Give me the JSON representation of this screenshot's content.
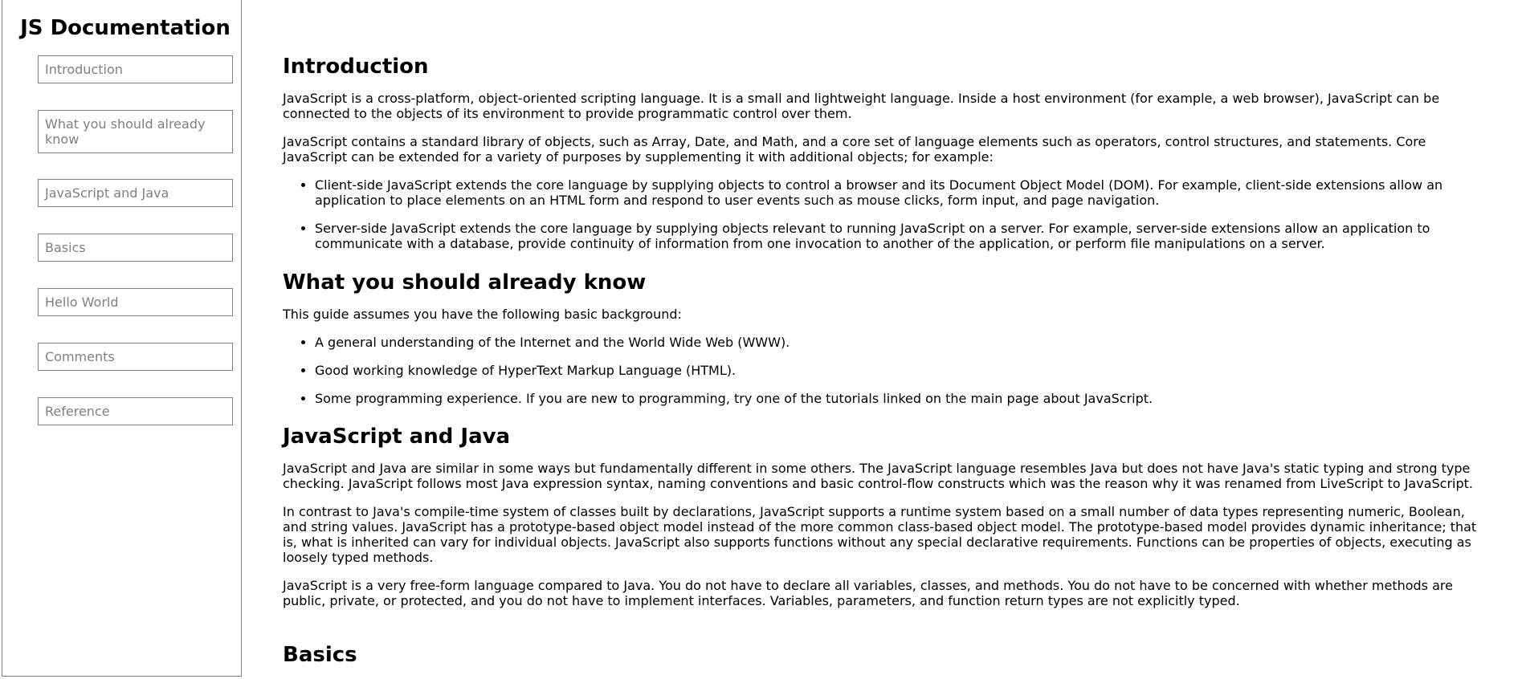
{
  "navbar": {
    "title": "JS Documentation",
    "links": [
      "Introduction",
      "What you should already know",
      "JavaScript and Java",
      "Basics",
      "Hello World",
      "Comments",
      "Reference"
    ]
  },
  "main": {
    "introduction": {
      "header": "Introduction",
      "p1": "JavaScript is a cross-platform, object-oriented scripting language. It is a small and lightweight language. Inside a host environment (for example, a web browser), JavaScript can be connected to the objects of its environment to provide programmatic control over them.",
      "p2": "JavaScript contains a standard library of objects, such as Array, Date, and Math, and a core set of language elements such as operators, control structures, and statements. Core JavaScript can be extended for a variety of purposes by supplementing it with additional objects; for example:",
      "items": [
        "Client-side JavaScript extends the core language by supplying objects to control a browser and its Document Object Model (DOM). For example, client-side extensions allow an application to place elements on an HTML form and respond to user events such as mouse clicks, form input, and page navigation.",
        "Server-side JavaScript extends the core language by supplying objects relevant to running JavaScript on a server. For example, server-side extensions allow an application to communicate with a database, provide continuity of information from one invocation to another of the application, or perform file manipulations on a server."
      ]
    },
    "what_you_should_know": {
      "header": "What you should already know",
      "p1": "This guide assumes you have the following basic background:",
      "items": [
        "A general understanding of the Internet and the World Wide Web (WWW).",
        "Good working knowledge of HyperText Markup Language (HTML).",
        "Some programming experience. If you are new to programming, try one of the tutorials linked on the main page about JavaScript."
      ]
    },
    "javascript_and_java": {
      "header": "JavaScript and Java",
      "p1": "JavaScript and Java are similar in some ways but fundamentally different in some others. The JavaScript language resembles Java but does not have Java's static typing and strong type checking. JavaScript follows most Java expression syntax, naming conventions and basic control-flow constructs which was the reason why it was renamed from LiveScript to JavaScript.",
      "p2": "In contrast to Java's compile-time system of classes built by declarations, JavaScript supports a runtime system based on a small number of data types representing numeric, Boolean, and string values. JavaScript has a prototype-based object model instead of the more common class-based object model. The prototype-based model provides dynamic inheritance; that is, what is inherited can vary for individual objects. JavaScript also supports functions without any special declarative requirements. Functions can be properties of objects, executing as loosely typed methods.",
      "p3": "JavaScript is a very free-form language compared to Java. You do not have to declare all variables, classes, and methods. You do not have to be concerned with whether methods are public, private, or protected, and you do not have to implement interfaces. Variables, parameters, and function return types are not explicitly typed."
    },
    "basics": {
      "header": "Basics"
    }
  }
}
